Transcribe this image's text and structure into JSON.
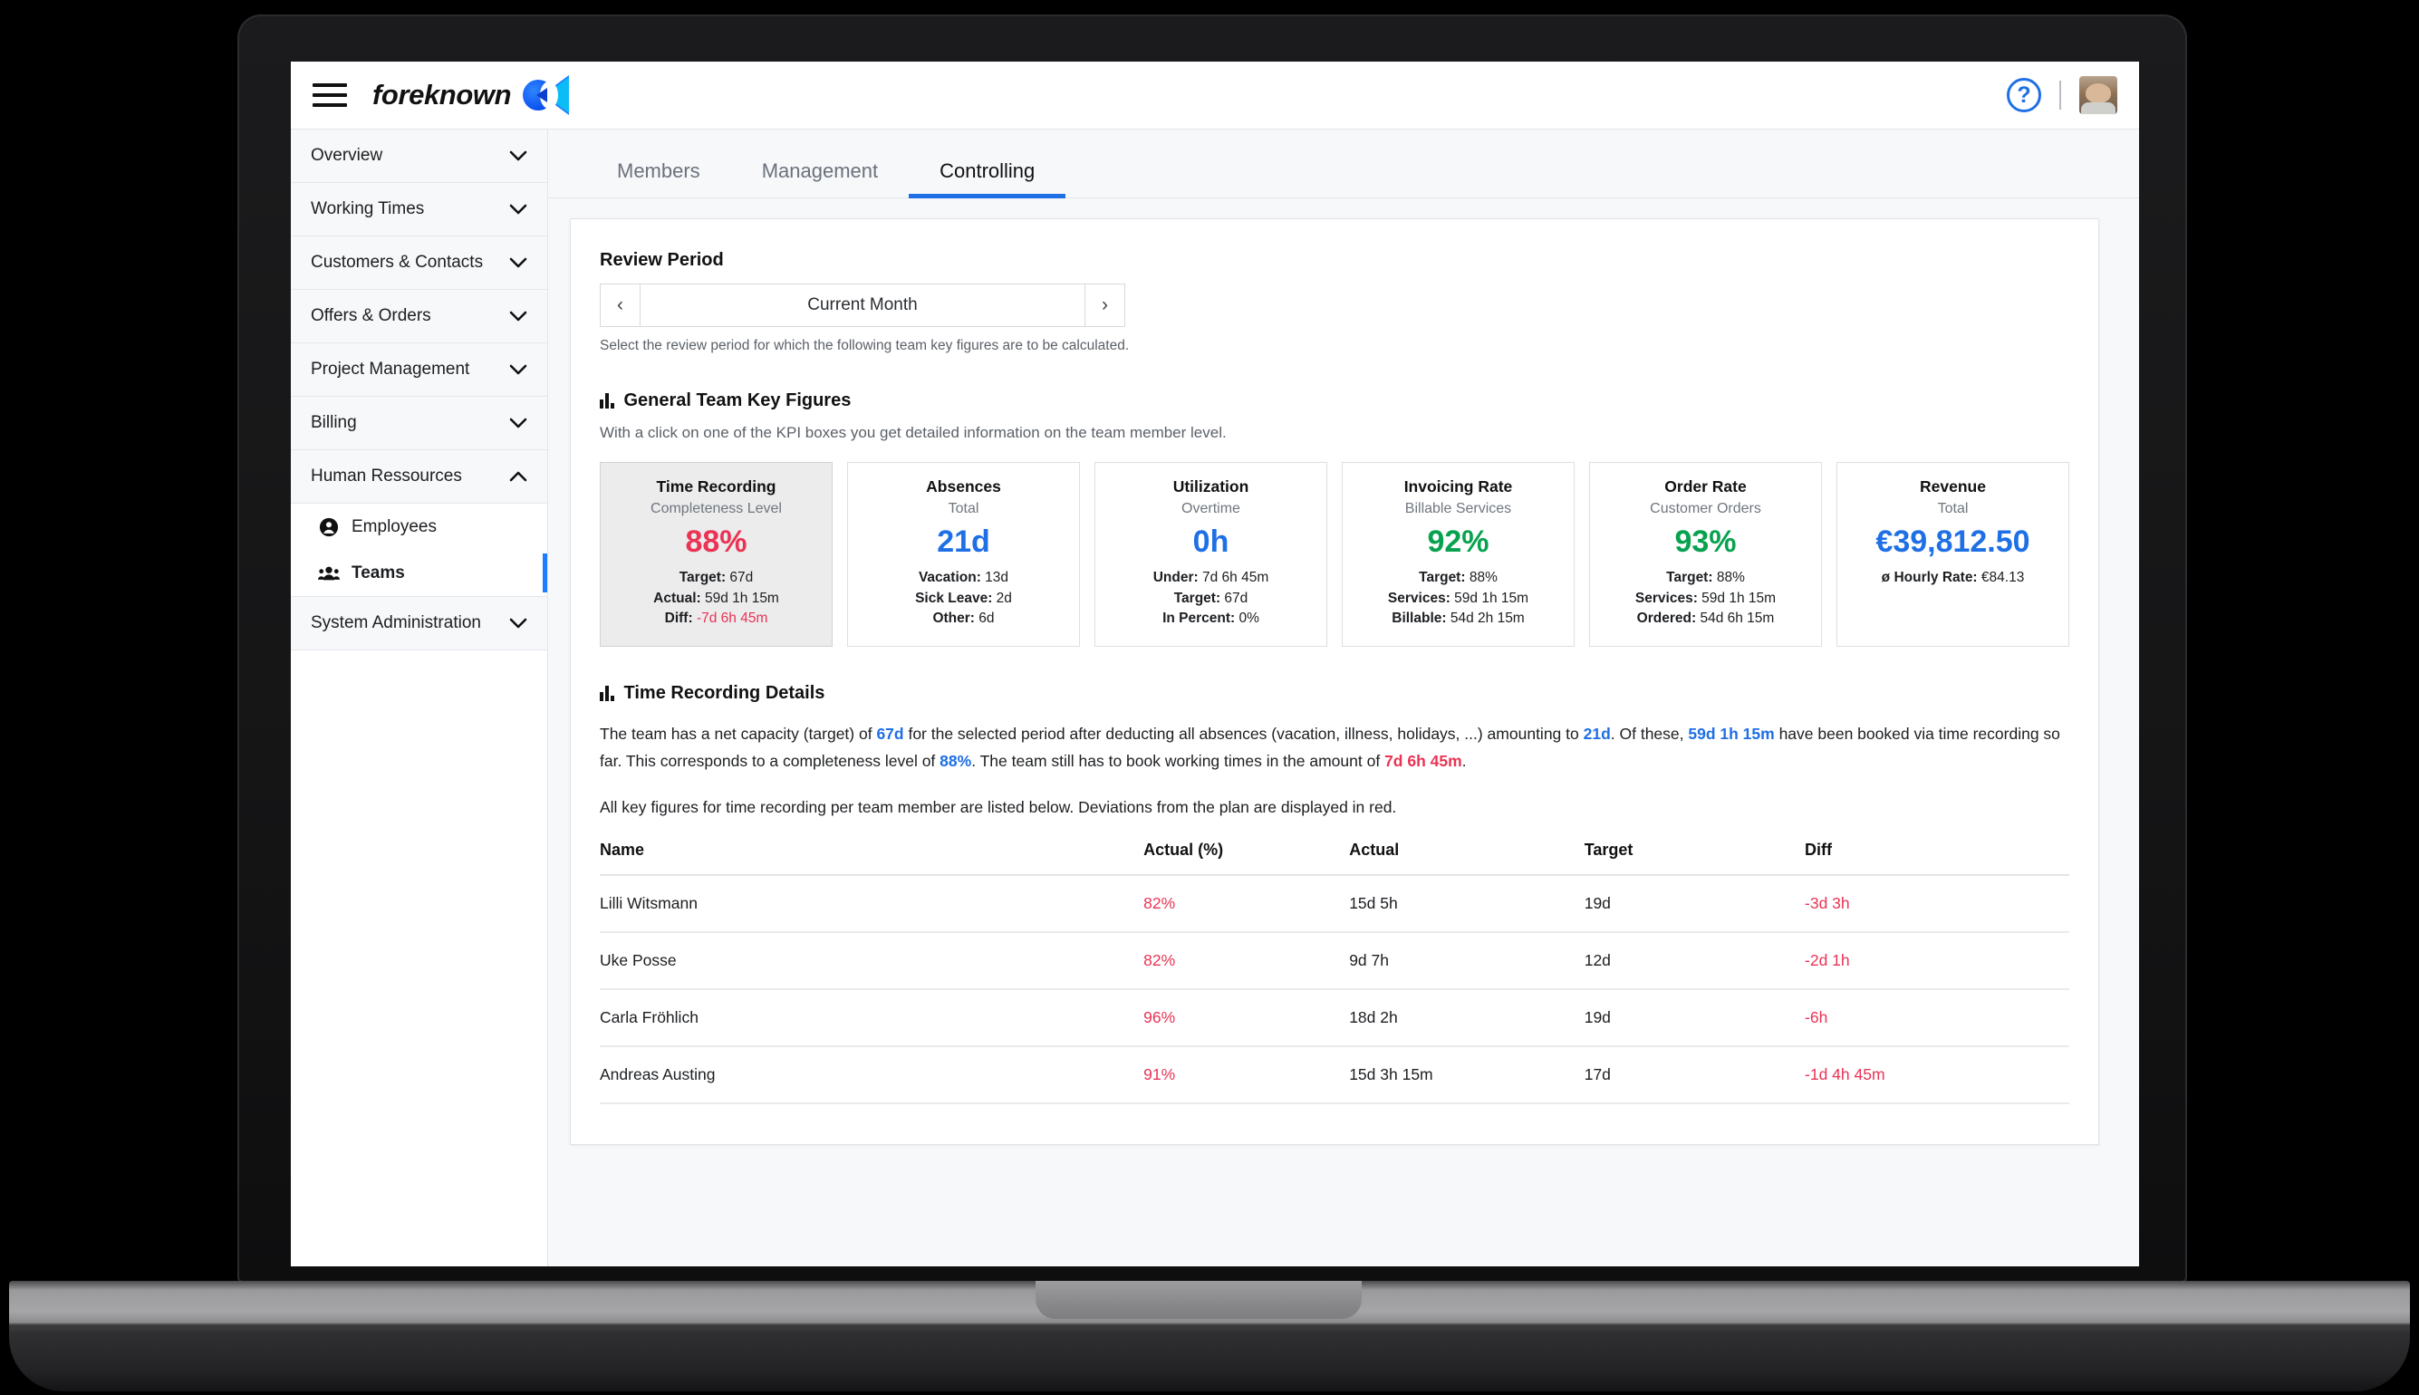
{
  "header": {
    "brand_name": "foreknown",
    "menu_icon": "hamburger-icon",
    "help_icon": "?",
    "avatar_icon": "user-avatar"
  },
  "sidebar": {
    "groups": [
      {
        "label": "Overview",
        "expanded": false
      },
      {
        "label": "Working Times",
        "expanded": false
      },
      {
        "label": "Customers & Contacts",
        "expanded": false
      },
      {
        "label": "Offers & Orders",
        "expanded": false
      },
      {
        "label": "Project Management",
        "expanded": false
      },
      {
        "label": "Billing",
        "expanded": false
      },
      {
        "label": "Human Ressources",
        "expanded": true
      },
      {
        "label": "System Administration",
        "expanded": false
      }
    ],
    "hr_children": [
      {
        "label": "Employees",
        "icon": "person-icon",
        "active": false
      },
      {
        "label": "Teams",
        "icon": "group-icon",
        "active": true
      }
    ]
  },
  "tabs": [
    {
      "label": "Members",
      "active": false
    },
    {
      "label": "Management",
      "active": false
    },
    {
      "label": "Controlling",
      "active": true
    }
  ],
  "review_period": {
    "title": "Review Period",
    "prev_label": "‹",
    "next_label": "›",
    "value": "Current Month",
    "hint": "Select the review period for which the following team key figures are to be calculated."
  },
  "key_figures": {
    "title": "General Team Key Figures",
    "subtitle": "With a click on one of the KPI boxes you get detailed information on the team member level.",
    "cards": [
      {
        "title": "Time Recording",
        "subtitle": "Completeness Level",
        "value": "88%",
        "value_color": "red",
        "selected": true,
        "lines": [
          {
            "label": "Target:",
            "value": "67d",
            "negative": false
          },
          {
            "label": "Actual:",
            "value": "59d 1h 15m",
            "negative": false
          },
          {
            "label": "Diff:",
            "value": "-7d 6h 45m",
            "negative": true
          }
        ]
      },
      {
        "title": "Absences",
        "subtitle": "Total",
        "value": "21d",
        "value_color": "blue",
        "selected": false,
        "lines": [
          {
            "label": "Vacation:",
            "value": "13d",
            "negative": false
          },
          {
            "label": "Sick Leave:",
            "value": "2d",
            "negative": false
          },
          {
            "label": "Other:",
            "value": "6d",
            "negative": false
          }
        ]
      },
      {
        "title": "Utilization",
        "subtitle": "Overtime",
        "value": "0h",
        "value_color": "blue",
        "selected": false,
        "lines": [
          {
            "label": "Under:",
            "value": "7d 6h 45m",
            "negative": false
          },
          {
            "label": "Target:",
            "value": "67d",
            "negative": false
          },
          {
            "label": "In Percent:",
            "value": "0%",
            "negative": false
          }
        ]
      },
      {
        "title": "Invoicing Rate",
        "subtitle": "Billable Services",
        "value": "92%",
        "value_color": "green",
        "selected": false,
        "lines": [
          {
            "label": "Target:",
            "value": "88%",
            "negative": false
          },
          {
            "label": "Services:",
            "value": "59d 1h 15m",
            "negative": false
          },
          {
            "label": "Billable:",
            "value": "54d 2h 15m",
            "negative": false
          }
        ]
      },
      {
        "title": "Order Rate",
        "subtitle": "Customer Orders",
        "value": "93%",
        "value_color": "green",
        "selected": false,
        "lines": [
          {
            "label": "Target:",
            "value": "88%",
            "negative": false
          },
          {
            "label": "Services:",
            "value": "59d 1h 15m",
            "negative": false
          },
          {
            "label": "Ordered:",
            "value": "54d 6h 15m",
            "negative": false
          }
        ]
      },
      {
        "title": "Revenue",
        "subtitle": "Total",
        "value": "€39,812.50",
        "value_color": "blue",
        "selected": false,
        "lines": [
          {
            "label": "ø Hourly Rate:",
            "value": "€84.13",
            "negative": false
          }
        ]
      }
    ]
  },
  "time_details": {
    "title": "Time Recording Details",
    "paragraph_parts": [
      {
        "t": "The team has a net capacity (target) of ",
        "style": "plain"
      },
      {
        "t": "67d",
        "style": "blue"
      },
      {
        "t": " for the selected period after deducting all absences (vacation, illness, holidays, ...) amounting to ",
        "style": "plain"
      },
      {
        "t": "21d",
        "style": "blue"
      },
      {
        "t": ". Of these, ",
        "style": "plain"
      },
      {
        "t": "59d 1h 15m",
        "style": "blue"
      },
      {
        "t": " have been booked via time recording so far. This corresponds to a completeness level of ",
        "style": "plain"
      },
      {
        "t": "88%",
        "style": "blue"
      },
      {
        "t": ". The team still has to book working times in the amount of ",
        "style": "plain"
      },
      {
        "t": "7d 6h 45m",
        "style": "red"
      },
      {
        "t": ".",
        "style": "plain"
      }
    ],
    "paragraph2": "All key figures for time recording per team member are listed below. Deviations from the plan are displayed in red.",
    "table": {
      "columns": [
        "Name",
        "Actual (%)",
        "Actual",
        "Target",
        "Diff"
      ],
      "rows": [
        {
          "name": "Lilli Witsmann",
          "actual_pct": "82%",
          "actual": "15d 5h",
          "target": "19d",
          "diff": "-3d 3h"
        },
        {
          "name": "Uke Posse",
          "actual_pct": "82%",
          "actual": "9d 7h",
          "target": "12d",
          "diff": "-2d 1h"
        },
        {
          "name": "Carla Fröhlich",
          "actual_pct": "96%",
          "actual": "18d 2h",
          "target": "19d",
          "diff": "-6h"
        },
        {
          "name": "Andreas Austing",
          "actual_pct": "91%",
          "actual": "15d 3h 15m",
          "target": "17d",
          "diff": "-1d 4h 45m"
        }
      ]
    }
  },
  "colors": {
    "accent_blue": "#1f6fe5",
    "red": "#ea3355",
    "green": "#07a24e",
    "bg": "#f7f8fa"
  }
}
